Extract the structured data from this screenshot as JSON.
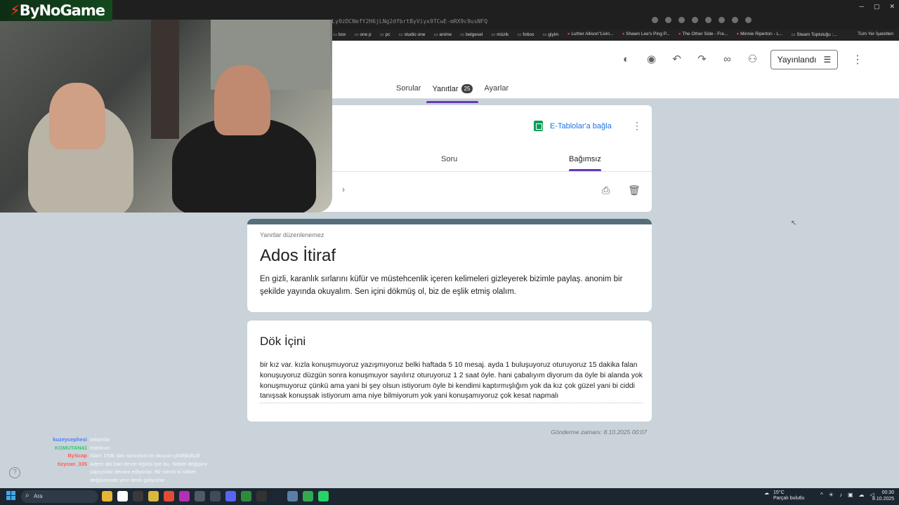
{
  "browser": {
    "url": "...Ly9zDCNefY2H6jLNg2dfbrtByViyx9TCwE-mRX9c9usNFQ",
    "bookmarks": [
      "box",
      "one p",
      "pc",
      "studio one",
      "anime",
      "belgesel",
      "müzik",
      "fottoo",
      "giyim"
    ],
    "bookmarks_youtube": [
      "Luther Allison\"Livin...",
      "Shawn Lee's Ping P...",
      "The Other Side - Fre...",
      "Minnie Riperton - L...",
      "Steam Topluluğu :..."
    ],
    "all_bookmarks": "Tüm Yer İşaretleri"
  },
  "toolbar": {
    "icons": [
      "palette-icon",
      "eye-icon",
      "undo-icon",
      "redo-icon",
      "link-icon",
      "add-person-icon"
    ],
    "publish_label": "Yayınlandı"
  },
  "tabs": [
    {
      "label": "Sorular"
    },
    {
      "label": "Yanıtlar",
      "count": "25"
    },
    {
      "label": "Ayarlar"
    }
  ],
  "responses": {
    "sheets_label": "E-Tablolar'a bağla",
    "subtab_question": "Soru",
    "subtab_individual": "Bağımsız"
  },
  "form": {
    "not_editable": "Yanıtlar düzenlenemez",
    "title": "Ados İtiraf",
    "description": "En gizli, karanlık sırlarını küfür ve müstehcenlik içeren kelimeleri gizleyerek bizimle paylaş. anonim bir şekilde yayında okuyalım. Sen içini dökmüş ol, biz de eşlik etmiş olalım."
  },
  "answer": {
    "question": "Dök İçini",
    "text": "bir kız var. kızla konuşmuyoruz yazışmıyoruz belki haftada 5 10 mesaj. ayda 1 buluşuyoruz oturuyoruz 15 dakika falan konuşuyoruz düzgün sonra konuşmuyor sayılırız oturuyoruz 1 2 saat öyle. hani çabalıyım diyorum da öyle bi alanda yok konuşmuyoruz çünkü ama yani bi şey olsun istiyorum öyle bi kendimi kaptırmışlığım yok da kız çok güzel yani bi ciddi tanışsak konuşsak istiyorum ama niye bilmiyorum yok yani konuşamıyoruz çok kesat napmalı",
    "submitted": "Gönderme zamanı: 8.10.2025 00:07"
  },
  "overlay": {
    "logo": "ByNoGame",
    "chat": [
      {
        "user": "kuzeycephesi",
        "msg": "selamlar",
        "color": "#4f7cff"
      },
      {
        "user": "KOMUTAN41",
        "msg": "mahkum",
        "color": "#2ecc71"
      },
      {
        "user": "ByScap",
        "msg": "Abim 15dk dan sonrasını bi okuyun çkldfjkdfçdf",
        "color": "#ff5c5c"
      },
      {
        "user": "tizycan_335",
        "msg": "Adem abi bari devre ilişkisi işte bu. Nöbet değişimi yapıyorlar devam ediyorlar. Bir sonra ki nöbet değişiminde yine denk geliyorlar",
        "color": "#ff5c5c"
      }
    ]
  },
  "taskbar": {
    "search": "Ara",
    "weather_temp": "15°C",
    "weather_desc": "Parçalı bulutlu",
    "time": "00:30",
    "date": "8.10.2025"
  }
}
